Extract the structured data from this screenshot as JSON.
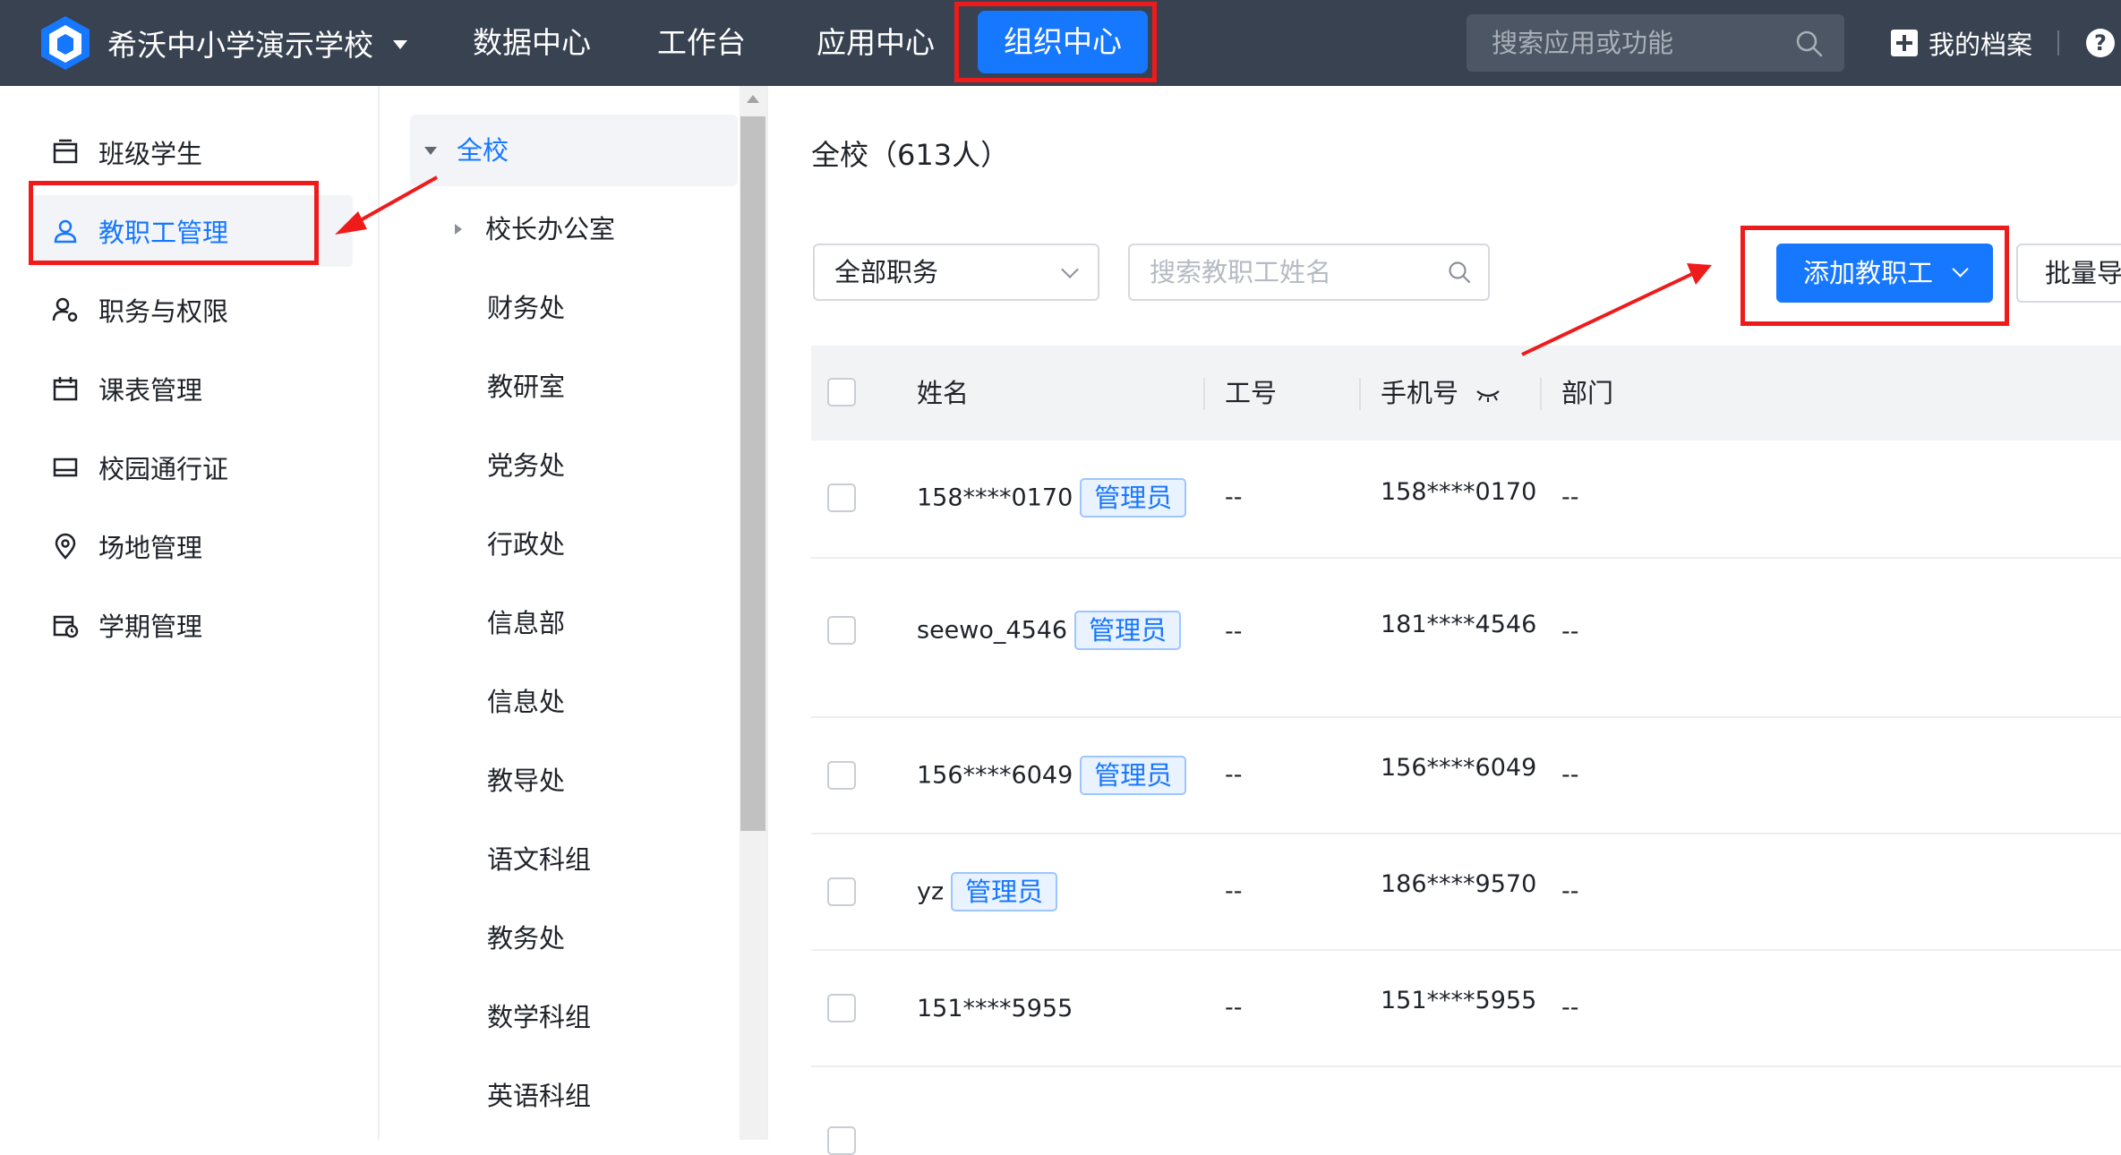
{
  "topbar": {
    "school_name": "希沃中小学演示学校",
    "nav": [
      "数据中心",
      "工作台",
      "应用中心"
    ],
    "nav_active": "组织中心",
    "search_placeholder": "搜索应用或功能",
    "profile_label": "我的档案",
    "help": "?"
  },
  "sidebar": {
    "items": [
      {
        "label": "班级学生",
        "icon": "calendar-board-icon"
      },
      {
        "label": "教职工管理",
        "icon": "user-icon"
      },
      {
        "label": "职务与权限",
        "icon": "user-permission-icon"
      },
      {
        "label": "课表管理",
        "icon": "calendar-icon"
      },
      {
        "label": "校园通行证",
        "icon": "card-icon"
      },
      {
        "label": "场地管理",
        "icon": "location-pin-icon"
      },
      {
        "label": "学期管理",
        "icon": "calendar-clock-icon"
      }
    ],
    "active_index": 1
  },
  "tree": {
    "root": "全校",
    "items": [
      "校长办公室",
      "财务处",
      "教研室",
      "党务处",
      "行政处",
      "信息部",
      "信息处",
      "教导处",
      "语文科组",
      "教务处",
      "数学科组",
      "英语科组"
    ]
  },
  "main": {
    "title": "全校（613人）",
    "role_filter": "全部职务",
    "name_search_placeholder": "搜索教职工姓名",
    "add_button": "添加教职工",
    "batch_button": "批量导入",
    "columns": [
      "姓名",
      "工号",
      "手机号",
      "部门"
    ],
    "rows": [
      {
        "name": "158****0170",
        "badge": "管理员",
        "id": "--",
        "phone": "158****0170",
        "dept": "--"
      },
      {
        "name": "seewo_4546",
        "badge": "管理员",
        "id": "--",
        "phone": "181****4546",
        "dept": "--"
      },
      {
        "name": "156****6049",
        "badge": "管理员",
        "id": "--",
        "phone": "156****6049",
        "dept": "--"
      },
      {
        "name": "yz",
        "badge": "管理员",
        "id": "--",
        "phone": "186****9570",
        "dept": "--"
      },
      {
        "name": "151****5955",
        "badge": "",
        "id": "--",
        "phone": "151****5955",
        "dept": "--"
      }
    ]
  },
  "colors": {
    "topbar_bg": "#384250",
    "accent": "#1677ff",
    "annotation_red": "#ef1b1b"
  }
}
